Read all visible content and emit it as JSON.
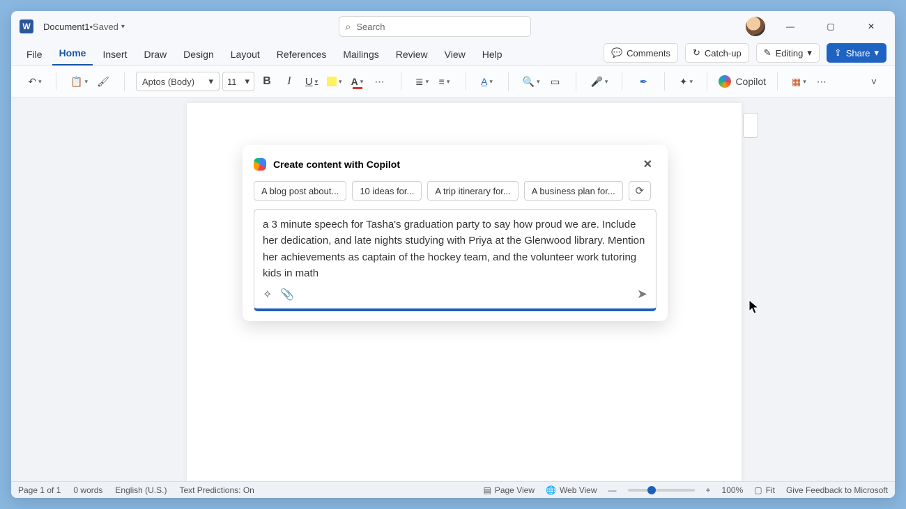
{
  "titlebar": {
    "app_letter": "W",
    "doc_title": "Document1",
    "status_sep": " • ",
    "status": "Saved",
    "search_placeholder": "Search"
  },
  "window_controls": {
    "min": "—",
    "max": "▢",
    "close": "✕"
  },
  "tabs": {
    "file": "File",
    "home": "Home",
    "insert": "Insert",
    "draw": "Draw",
    "design": "Design",
    "layout": "Layout",
    "references": "References",
    "mailings": "Mailings",
    "review": "Review",
    "view": "View",
    "help": "Help"
  },
  "tab_actions": {
    "comments": "Comments",
    "catchup": "Catch-up",
    "editing": "Editing",
    "share": "Share"
  },
  "ribbon": {
    "font_name": "Aptos (Body)",
    "font_size": "11",
    "copilot": "Copilot"
  },
  "copilot_panel": {
    "title": "Create content with Copilot",
    "chips": {
      "c1": "A blog post about...",
      "c2": "10 ideas for...",
      "c3": "A trip itinerary for...",
      "c4": "A business plan for..."
    },
    "prompt": "a 3 minute speech for Tasha's graduation party to say how proud we are. Include her dedication, and late nights studying with Priya at the Glenwood library. Mention her achievements as captain of the hockey team, and the volunteer work tutoring kids in math"
  },
  "statusbar": {
    "page": "Page 1 of 1",
    "words": "0 words",
    "lang": "English (U.S.)",
    "predictions": "Text Predictions: On",
    "page_view": "Page View",
    "web_view": "Web View",
    "zoom": "100%",
    "fit": "Fit",
    "feedback": "Give Feedback to Microsoft"
  }
}
